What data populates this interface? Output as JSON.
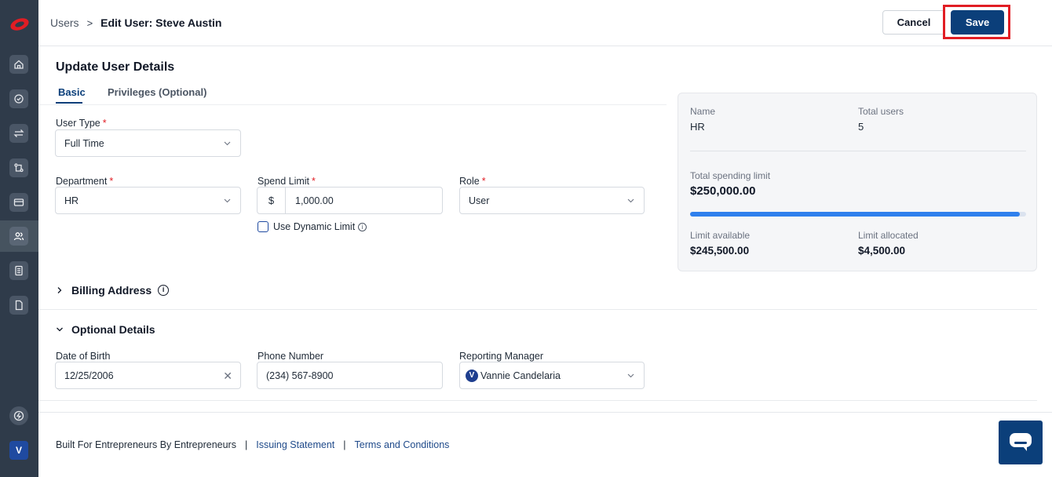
{
  "header": {
    "breadcrumb_parent": "Users",
    "breadcrumb_separator": ">",
    "breadcrumb_current": "Edit User: Steve Austin",
    "cancel_label": "Cancel",
    "save_label": "Save"
  },
  "page": {
    "title": "Update User Details",
    "tabs": [
      {
        "label": "Basic",
        "active": true
      },
      {
        "label": "Privileges (Optional)",
        "active": false
      }
    ]
  },
  "form": {
    "user_type": {
      "label": "User Type",
      "required_mark": "*",
      "value": "Full Time"
    },
    "department": {
      "label": "Department",
      "required_mark": "*",
      "value": "HR"
    },
    "spend_limit": {
      "label": "Spend Limit",
      "required_mark": "*",
      "currency": "$",
      "value": "1,000.00"
    },
    "role": {
      "label": "Role",
      "required_mark": "*",
      "value": "User"
    },
    "dynamic_limit": {
      "label": "Use Dynamic Limit",
      "checked": false
    }
  },
  "summary": {
    "name_label": "Name",
    "name_value": "HR",
    "total_users_label": "Total users",
    "total_users_value": "5",
    "total_limit_label": "Total spending limit",
    "total_limit_value": "$250,000.00",
    "usage_fraction": 0.982,
    "available_label": "Limit available",
    "available_value": "$245,500.00",
    "allocated_label": "Limit allocated",
    "allocated_value": "$4,500.00"
  },
  "billing": {
    "title": "Billing Address",
    "expanded": false
  },
  "optional": {
    "title": "Optional Details",
    "expanded": true,
    "dob": {
      "label": "Date of Birth",
      "value": "12/25/2006"
    },
    "phone": {
      "label": "Phone Number",
      "value": "(234) 567-8900"
    },
    "manager": {
      "label": "Reporting Manager",
      "initial": "V",
      "value": "Vannie Candelaria"
    }
  },
  "footer": {
    "tagline": "Built For Entrepreneurs By Entrepreneurs",
    "separator": "|",
    "issuing_link": "Issuing Statement",
    "terms_link": "Terms and Conditions"
  },
  "sidebar": {
    "items": [
      "home-icon",
      "approvals-icon",
      "transfer-icon",
      "workflow-icon",
      "card-icon",
      "users-icon",
      "ledger-icon",
      "document-icon"
    ],
    "active": "users-icon",
    "bottom_icon": "bolt-icon",
    "user_initial": "V"
  },
  "colors": {
    "brand_primary": "#0b3f7a",
    "sidebar_bg": "#2f3b4a",
    "highlight_red": "#e11d24",
    "progress_blue": "#2f80ed"
  }
}
